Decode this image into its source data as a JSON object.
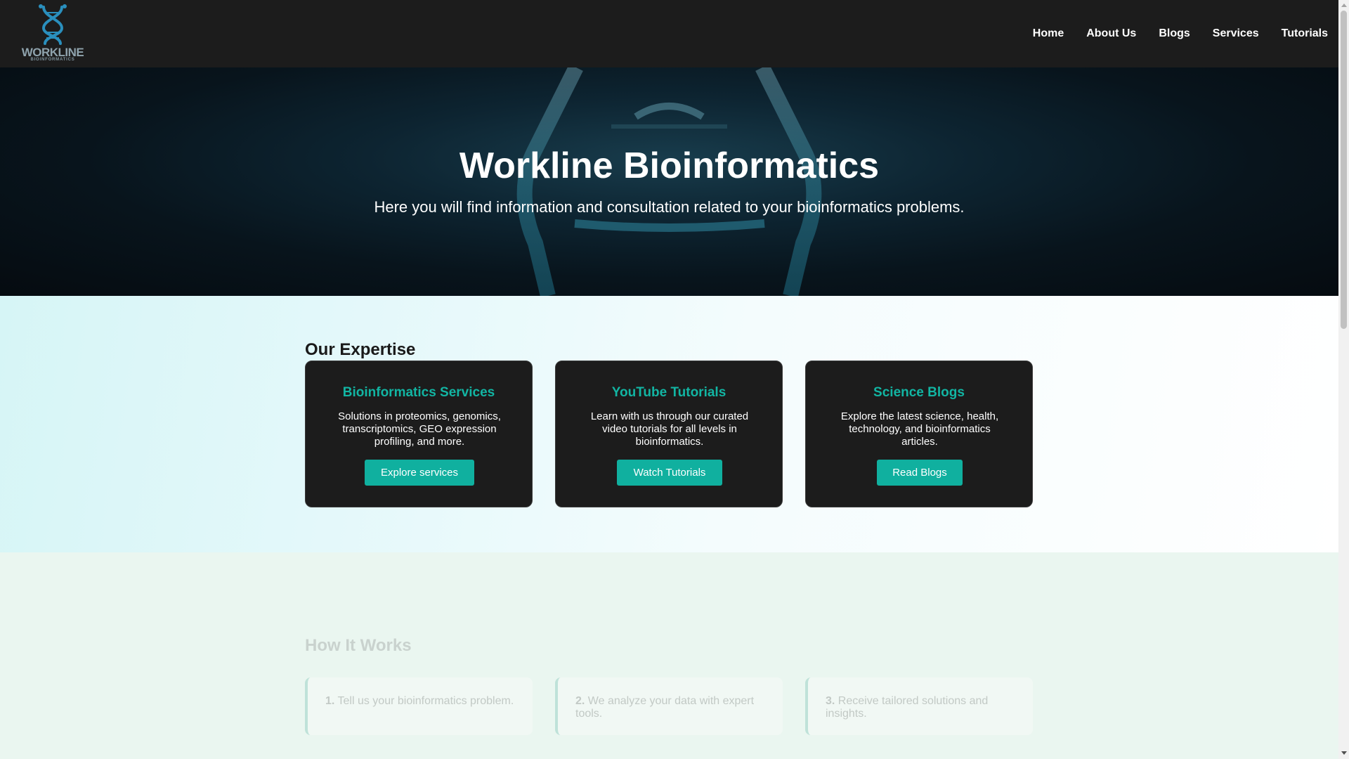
{
  "brand": {
    "logo_word": "WORKLINE",
    "logo_sub": "BIOINFORMATICS",
    "accent": "#10b09f",
    "logo_color": "#2a8fbd"
  },
  "nav": {
    "links": [
      "Home",
      "About Us",
      "Blogs",
      "Services",
      "Tutorials"
    ]
  },
  "hero": {
    "title": "Workline Bioinformatics",
    "subtitle": "Here you will find information and consultation related to your bioinformatics problems."
  },
  "expertise": {
    "title": "Our Expertise",
    "cards": [
      {
        "title": "Bioinformatics Services",
        "text": "Solutions in proteomics, genomics, transcriptomics, GEO expression profiling, and more.",
        "button": "Explore services"
      },
      {
        "title": "YouTube Tutorials",
        "text": "Learn with us through our curated video tutorials for all levels in bioinformatics.",
        "button": "Watch Tutorials"
      },
      {
        "title": "Science Blogs",
        "text": "Explore the latest science, health, technology, and bioinformatics articles.",
        "button": "Read Blogs"
      }
    ]
  },
  "how": {
    "title": "How It Works",
    "steps": [
      {
        "num": "1.",
        "text": "Tell us your bioinformatics problem."
      },
      {
        "num": "2.",
        "text": "We analyze your data with expert tools."
      },
      {
        "num": "3.",
        "text": "Receive tailored solutions and insights."
      }
    ]
  }
}
